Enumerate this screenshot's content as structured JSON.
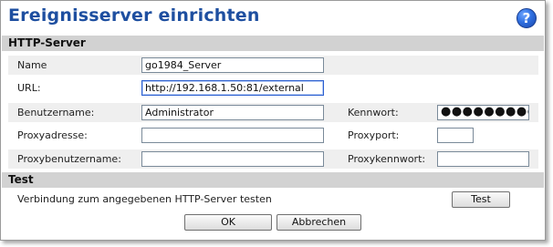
{
  "window": {
    "title": "Ereignisserver einrichten",
    "help_icon": "question-mark-help-icon",
    "help_glyph": "?"
  },
  "http_server": {
    "section_title": "HTTP-Server",
    "name_label": "Name",
    "name_value": "go1984_Server",
    "url_label": "URL:",
    "url_value": "http://192.168.1.50:81/external",
    "username_label": "Benutzername:",
    "username_value": "Administrator",
    "password_label": "Kennwort:",
    "password_value": "●●●●●●●●●",
    "proxy_address_label": "Proxyadresse:",
    "proxy_address_value": "",
    "proxy_port_label": "Proxyport:",
    "proxy_port_value": "",
    "proxy_username_label": "Proxybenutzername:",
    "proxy_username_value": "",
    "proxy_password_label": "Proxykennwort:",
    "proxy_password_value": ""
  },
  "test": {
    "section_title": "Test",
    "description": "Verbindung zum angegebenen HTTP-Server testen",
    "test_button": "Test"
  },
  "footer": {
    "ok_button": "OK",
    "cancel_button": "Abbrechen"
  },
  "colors": {
    "title": "#1e4fa0",
    "section_bg": "#d2d2d2",
    "row_alt_bg": "#efefef",
    "focus_border": "#2b5fd0"
  }
}
